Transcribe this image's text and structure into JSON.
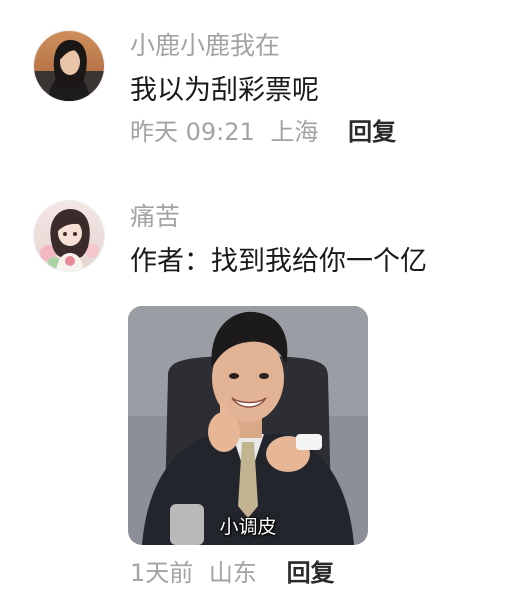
{
  "comments": [
    {
      "username": "小鹿小鹿我在",
      "text": "我以为刮彩票呢",
      "time": "昨天 09:21",
      "location": "上海",
      "reply_label": "回复",
      "avatar_icon": "user-avatar-photo"
    },
    {
      "username": "痛苦",
      "text": "作者：找到我给你一个亿",
      "time": "1天前",
      "location": "山东",
      "reply_label": "回复",
      "avatar_icon": "user-avatar-illustration",
      "sticker": {
        "caption": "小调皮",
        "icon": "meme-sticker-image"
      }
    }
  ]
}
